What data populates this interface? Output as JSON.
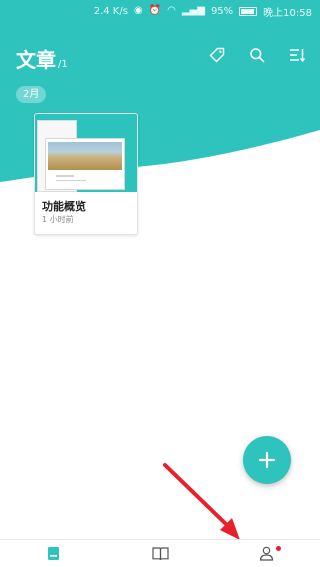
{
  "status_bar": {
    "net_speed": "2.4 K/s",
    "battery": "95%",
    "time": "晚上10:58"
  },
  "header": {
    "title": "文章",
    "count": "/1",
    "icons": [
      "tag-icon",
      "search-icon",
      "sort-list-icon"
    ]
  },
  "month_chip": "2月",
  "articles": [
    {
      "title": "功能概览",
      "time": "1 小时前"
    }
  ],
  "bottom_nav": {
    "items": [
      "articles-tab-icon",
      "book-tab-icon",
      "profile-tab-icon"
    ],
    "active": 0
  },
  "colors": {
    "teal": "#2ec4bd",
    "red_dot": "#e8202a"
  }
}
